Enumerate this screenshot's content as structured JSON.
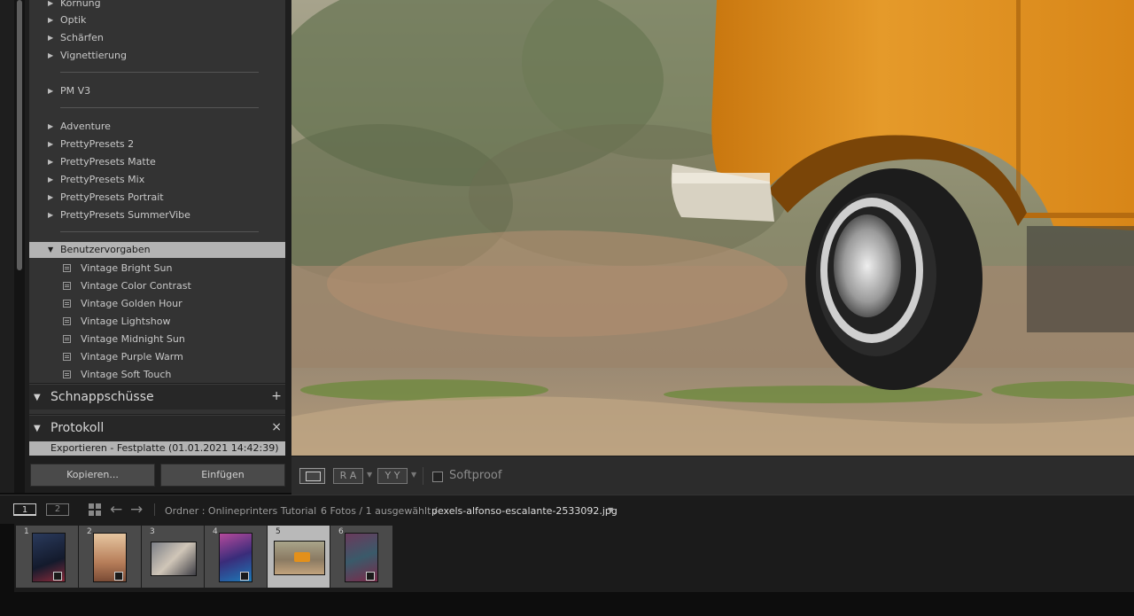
{
  "develop_panel": {
    "top_items": [
      "Körnung",
      "Optik",
      "Schärfen",
      "Vignettierung"
    ],
    "group_a": [
      "PM V3"
    ],
    "group_b": [
      "Adventure",
      "PrettyPresets 2",
      "PrettyPresets Matte",
      "PrettyPresets Mix",
      "PrettyPresets Portrait",
      "PrettyPresets SummerVibe"
    ],
    "user_presets_folder": "Benutzervorgaben",
    "user_presets": [
      "Vintage Bright Sun",
      "Vintage Color Contrast",
      "Vintage Golden Hour",
      "Vintage Lightshow",
      "Vintage Midnight Sun",
      "Vintage Purple Warm",
      "Vintage Soft Touch"
    ]
  },
  "snapshots": {
    "title": "Schnappschüsse",
    "action": "+"
  },
  "history": {
    "title": "Protokoll",
    "action": "×",
    "entry": "Exportieren - Festplatte (01.01.2021 14:42:39)"
  },
  "buttons": {
    "copy": "Kopieren...",
    "paste": "Einfügen"
  },
  "toolbar": {
    "ra": "R A",
    "yy": "Y Y",
    "softproof": "Softproof"
  },
  "filmstrip_header": {
    "screen1": "1",
    "screen2": "2",
    "folder": "Ordner : Onlineprinters Tutorial",
    "count": "6 Fotos /  1 ausgewählt /",
    "filename": "pexels-alfonso-escalante-2533092.jpg"
  },
  "filmstrip": {
    "numbers": [
      "1",
      "2",
      "3",
      "4",
      "5",
      "6"
    ],
    "selected_index": 5
  },
  "colors": {
    "van": "#e3901a",
    "panel": "#333333",
    "selected_row": "#b3b3b3"
  }
}
